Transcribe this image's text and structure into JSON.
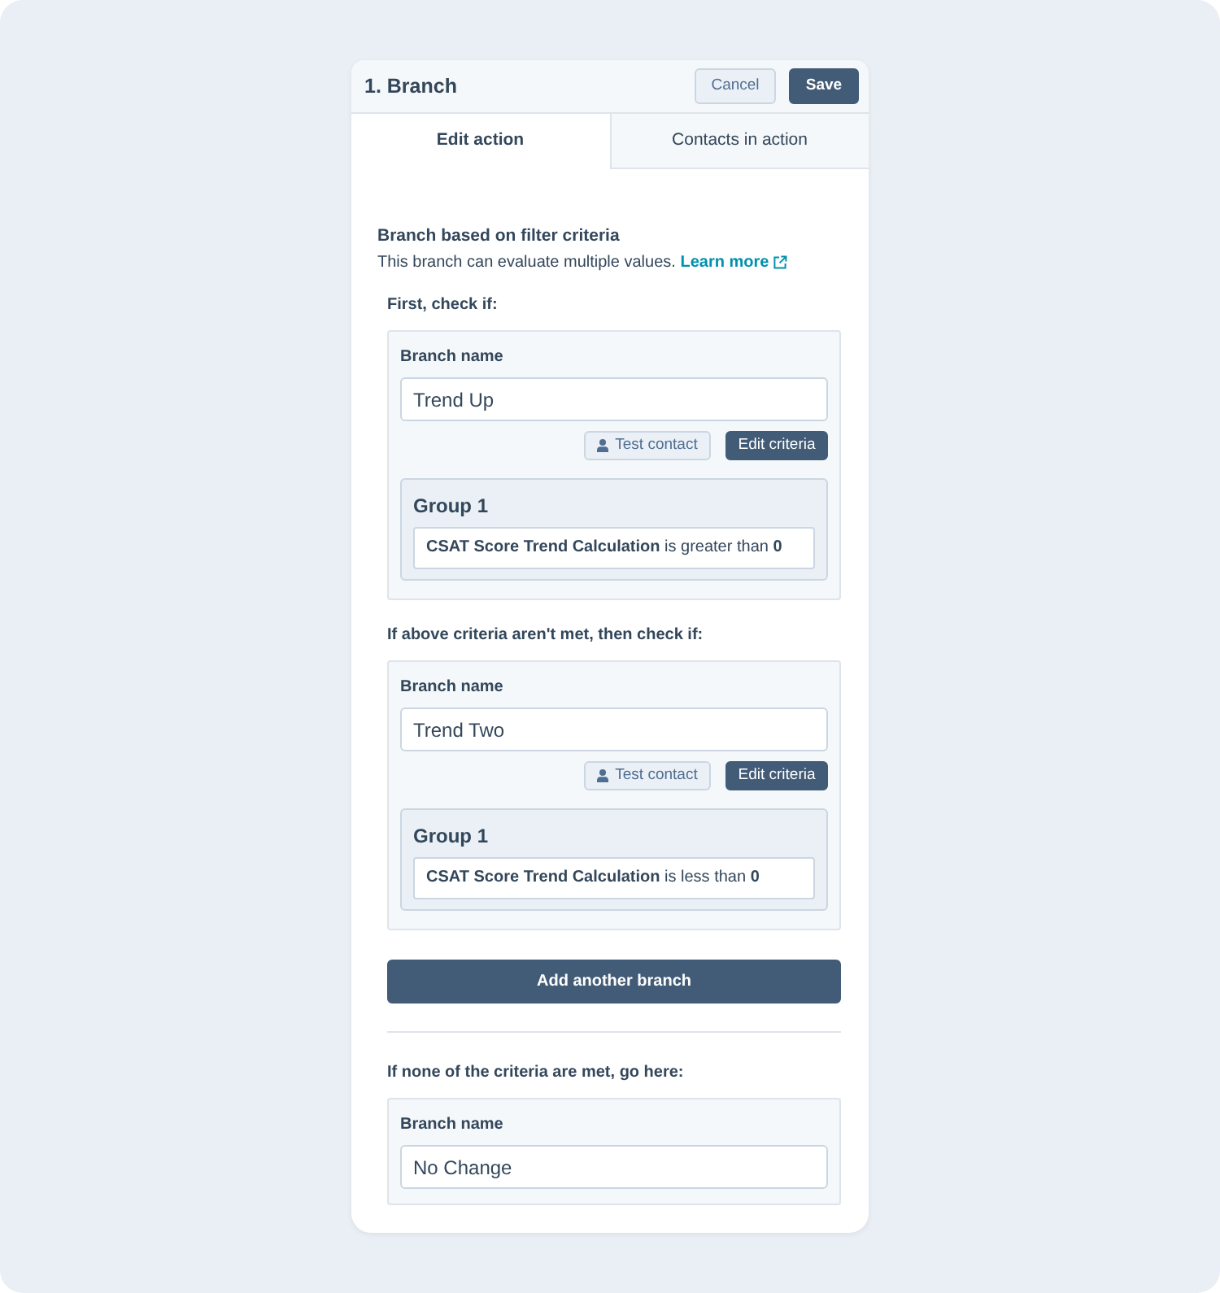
{
  "panel": {
    "title": "1. Branch",
    "cancel_button": "Cancel",
    "save_button": "Save"
  },
  "tabs": [
    {
      "label": "Edit action",
      "selected": true
    },
    {
      "label": "Contacts in action",
      "selected": false
    }
  ],
  "intro": {
    "heading": "Branch based on filter criteria",
    "text": "This branch can evaluate multiple values.",
    "link": "Learn more"
  },
  "branches": [
    {
      "heading": "First, check if:",
      "name_label": "Branch name",
      "name": "Trend Up",
      "test_button": "Test contact",
      "edit_button": "Edit criteria",
      "groups": [
        {
          "title": "Group 1",
          "criteria": [
            "**CSAT Score Trend Calculation** is greater than **0**"
          ]
        }
      ]
    },
    {
      "heading": "If above criteria aren't met, then check if:",
      "name_label": "Branch name",
      "name": "Trend Two",
      "test_button": "Test contact",
      "edit_button": "Edit criteria",
      "groups": [
        {
          "title": "Group 1",
          "criteria": [
            "**CSAT Score Trend Calculation** is less than **0**"
          ]
        }
      ]
    }
  ],
  "add_button": "Add another branch",
  "fallback": {
    "heading": "If none of the criteria are met, go here:",
    "name_label": "Branch name",
    "name": "No Change"
  }
}
